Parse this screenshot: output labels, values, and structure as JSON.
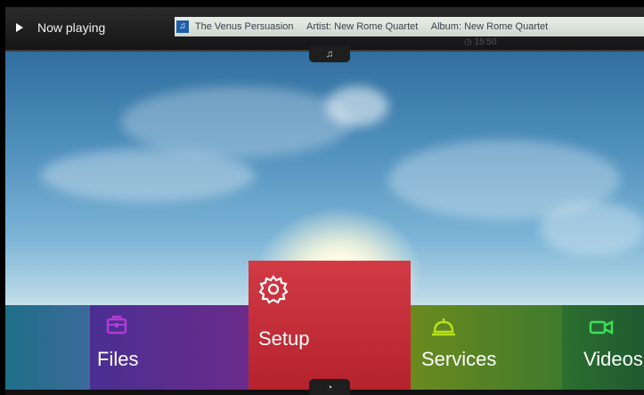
{
  "topbar": {
    "now_playing_label": "Now playing",
    "track_title": "The Venus Persuasion",
    "artist": "Artist: New Rome Quartet",
    "album": "Album: New Rome Quartet",
    "clock": "15:50",
    "music_tab_icon": "music-note-icon"
  },
  "menu": {
    "files_label": "Files",
    "setup_label": "Setup",
    "services_label": "Services",
    "videos_label": "Videos"
  },
  "icons": {
    "files": "briefcase-icon",
    "setup": "gear-icon",
    "services": "service-bell-icon",
    "videos": "video-camera-icon",
    "bottom_tab": "speedometer-icon"
  },
  "colors": {
    "setup_tile": "#c72b35",
    "files_icon": "#b23bd6",
    "services_icon": "#b7e21a",
    "videos_icon": "#3ee05a"
  }
}
